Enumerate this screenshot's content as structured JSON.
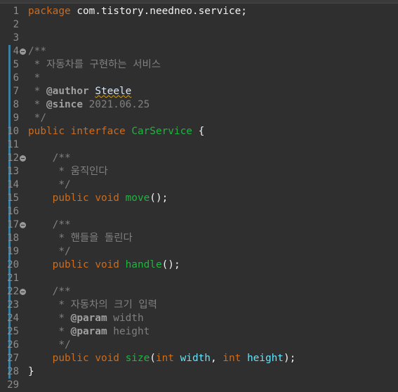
{
  "editor": {
    "lines": [
      {
        "n": "1",
        "parts": [
          [
            "kw",
            "package"
          ],
          [
            "plain",
            " com.tistory.needneo.service;"
          ]
        ]
      },
      {
        "n": "2",
        "parts": []
      },
      {
        "n": "3",
        "parts": []
      },
      {
        "n": "4",
        "fold": true,
        "changed": true,
        "parts": [
          [
            "cm",
            "/**"
          ]
        ]
      },
      {
        "n": "5",
        "changed": true,
        "parts": [
          [
            "cm",
            " * 자동차를 구현하는 서비스"
          ]
        ]
      },
      {
        "n": "6",
        "changed": true,
        "parts": [
          [
            "cm",
            " *"
          ]
        ]
      },
      {
        "n": "7",
        "changed": true,
        "parts": [
          [
            "cm",
            " * "
          ],
          [
            "tag",
            "@author"
          ],
          [
            "cm",
            " "
          ],
          [
            "sq",
            "Steele"
          ]
        ]
      },
      {
        "n": "8",
        "changed": true,
        "parts": [
          [
            "cm",
            " * "
          ],
          [
            "tag",
            "@since"
          ],
          [
            "cm",
            " 2021.06.25"
          ]
        ]
      },
      {
        "n": "9",
        "changed": true,
        "parts": [
          [
            "cm",
            " */"
          ]
        ]
      },
      {
        "n": "10",
        "changed": true,
        "parts": [
          [
            "kw",
            "public"
          ],
          [
            "plain",
            " "
          ],
          [
            "kw",
            "interface"
          ],
          [
            "plain",
            " "
          ],
          [
            "iface",
            "CarService"
          ],
          [
            "plain",
            " {"
          ]
        ]
      },
      {
        "n": "11",
        "changed": true,
        "parts": []
      },
      {
        "n": "12",
        "fold": true,
        "changed": true,
        "parts": [
          [
            "plain",
            "    "
          ],
          [
            "cm",
            "/**"
          ]
        ]
      },
      {
        "n": "13",
        "changed": true,
        "parts": [
          [
            "cm",
            "     * 움직인다"
          ]
        ]
      },
      {
        "n": "14",
        "changed": true,
        "parts": [
          [
            "cm",
            "     */"
          ]
        ]
      },
      {
        "n": "15",
        "changed": true,
        "parts": [
          [
            "plain",
            "    "
          ],
          [
            "kw",
            "public"
          ],
          [
            "plain",
            " "
          ],
          [
            "kw",
            "void"
          ],
          [
            "plain",
            " "
          ],
          [
            "method",
            "move"
          ],
          [
            "plain",
            "();"
          ]
        ]
      },
      {
        "n": "16",
        "changed": true,
        "parts": []
      },
      {
        "n": "17",
        "fold": true,
        "changed": true,
        "parts": [
          [
            "plain",
            "    "
          ],
          [
            "cm",
            "/**"
          ]
        ]
      },
      {
        "n": "18",
        "changed": true,
        "parts": [
          [
            "cm",
            "     * 핸들을 돌린다"
          ]
        ]
      },
      {
        "n": "19",
        "changed": true,
        "parts": [
          [
            "cm",
            "     */"
          ]
        ]
      },
      {
        "n": "20",
        "changed": true,
        "parts": [
          [
            "plain",
            "    "
          ],
          [
            "kw",
            "public"
          ],
          [
            "plain",
            " "
          ],
          [
            "kw",
            "void"
          ],
          [
            "plain",
            " "
          ],
          [
            "method",
            "handle"
          ],
          [
            "plain",
            "();"
          ]
        ]
      },
      {
        "n": "21",
        "changed": true,
        "parts": []
      },
      {
        "n": "22",
        "fold": true,
        "changed": true,
        "parts": [
          [
            "plain",
            "    "
          ],
          [
            "cm",
            "/**"
          ]
        ]
      },
      {
        "n": "23",
        "changed": true,
        "parts": [
          [
            "cm",
            "     * 자동차의 크기 입력"
          ]
        ]
      },
      {
        "n": "24",
        "changed": true,
        "parts": [
          [
            "cm",
            "     * "
          ],
          [
            "tag",
            "@param"
          ],
          [
            "cm",
            " width"
          ]
        ]
      },
      {
        "n": "25",
        "changed": true,
        "parts": [
          [
            "cm",
            "     * "
          ],
          [
            "tag",
            "@param"
          ],
          [
            "cm",
            " height"
          ]
        ]
      },
      {
        "n": "26",
        "changed": true,
        "parts": [
          [
            "cm",
            "     */"
          ]
        ]
      },
      {
        "n": "27",
        "changed": true,
        "parts": [
          [
            "plain",
            "    "
          ],
          [
            "kw",
            "public"
          ],
          [
            "plain",
            " "
          ],
          [
            "kw",
            "void"
          ],
          [
            "plain",
            " "
          ],
          [
            "method",
            "size"
          ],
          [
            "plain",
            "("
          ],
          [
            "kw",
            "int"
          ],
          [
            "plain",
            " "
          ],
          [
            "field",
            "width"
          ],
          [
            "plain",
            ", "
          ],
          [
            "kw",
            "int"
          ],
          [
            "plain",
            " "
          ],
          [
            "field",
            "height"
          ],
          [
            "plain",
            ");"
          ]
        ]
      },
      {
        "n": "28",
        "changed": true,
        "parts": [
          [
            "plain",
            "}"
          ]
        ]
      },
      {
        "n": "29",
        "parts": []
      }
    ]
  }
}
